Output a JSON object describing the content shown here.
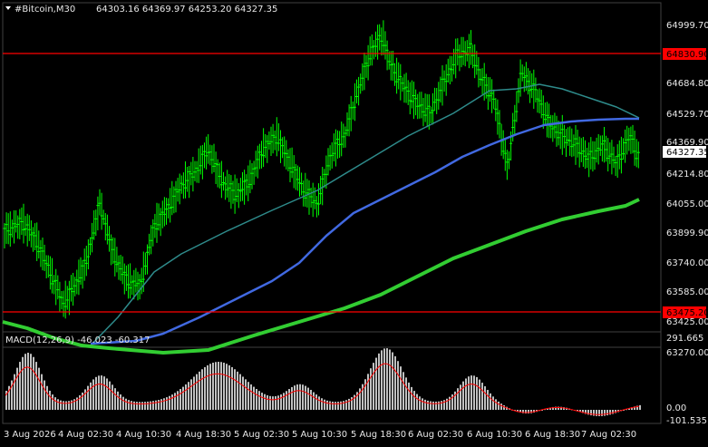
{
  "window": {
    "symbol_timeframe": "#Bitcoin,M30",
    "ohlc": "64303.16 64369.97 64253.20 64327.35"
  },
  "price_axis": {
    "labels": [
      "64999.70",
      "64684.80",
      "64529.70",
      "64369.90",
      "64214.80",
      "64055.00",
      "63899.90",
      "63740.00",
      "63585.00",
      "63425.00",
      "63270.00"
    ],
    "current_price": "64327.35",
    "levels": [
      {
        "price": "64830.90",
        "color": "#ff0000"
      },
      {
        "price": "63475.20",
        "color": "#ff0000"
      }
    ]
  },
  "time_axis": {
    "labels": [
      "3 Aug 2026",
      "4 Aug 02:30",
      "4 Aug 10:30",
      "4 Aug 18:30",
      "5 Aug 02:30",
      "5 Aug 10:30",
      "5 Aug 18:30",
      "6 Aug 02:30",
      "6 Aug 10:30",
      "6 Aug 18:30",
      "7 Aug 02:30"
    ]
  },
  "macd": {
    "label": "MACD(12,26,9) -46.023 -60.317",
    "axis_labels": [
      "291.665",
      "0.00",
      "-101.535"
    ]
  },
  "colors": {
    "background": "#000000",
    "candles": "#00ff00",
    "ma_fast": "#2e8b8b",
    "ma_mid": "#4169e1",
    "ma_slow": "#32cd32",
    "level_line": "#ff0000",
    "macd_hist": "#c0c0c0",
    "macd_signal": "#ff0000"
  },
  "chart_data": {
    "type": "candlestick",
    "series": [
      {
        "name": "price",
        "y_range": [
          63270,
          65000
        ]
      },
      {
        "name": "macd_histogram",
        "y_range": [
          -101.535,
          291.665
        ]
      }
    ]
  }
}
